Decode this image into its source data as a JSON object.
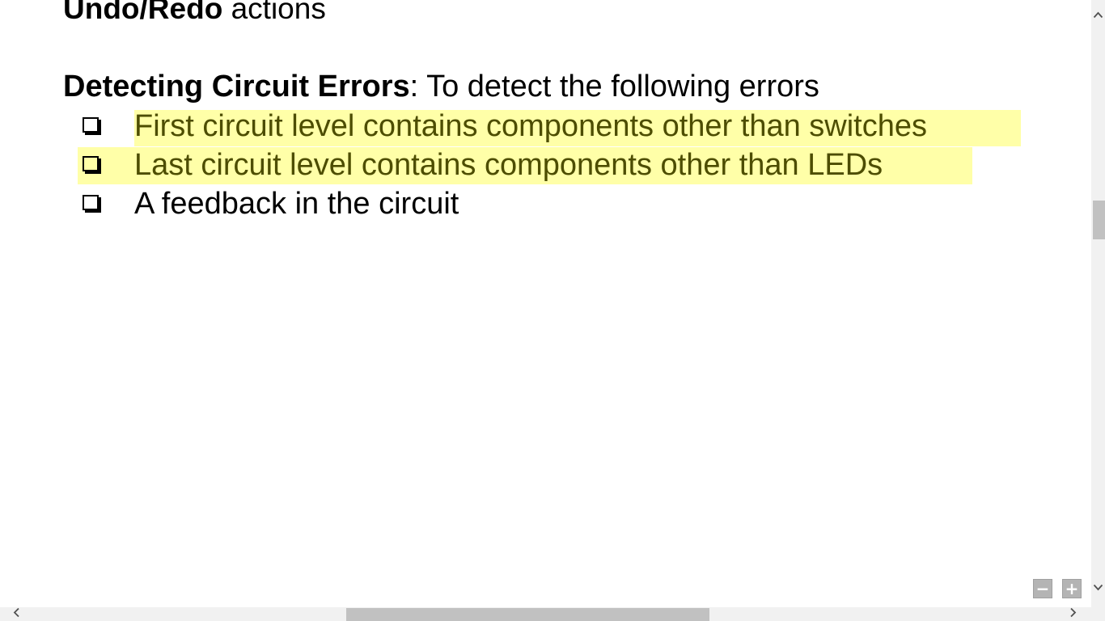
{
  "document": {
    "top_line": {
      "bold": "Undo/Redo",
      "rest": " actions"
    },
    "heading": {
      "bold": "Detecting Circuit Errors",
      "rest": ": To detect the following errors"
    },
    "items": [
      {
        "text": "First circuit level contains components other than switches",
        "highlighted": true
      },
      {
        "text": "Last circuit level contains components other than LEDs",
        "highlighted": true
      },
      {
        "text": "A feedback in the circuit",
        "highlighted": false
      }
    ],
    "highlight_color": "#ffff99"
  },
  "controls": {
    "zoom_out_label": "−",
    "zoom_in_label": "+",
    "scroll_up_icon": "chevron-up-icon",
    "scroll_down_icon": "chevron-down-icon",
    "scroll_left_icon": "chevron-left-icon",
    "scroll_right_icon": "chevron-right-icon"
  }
}
